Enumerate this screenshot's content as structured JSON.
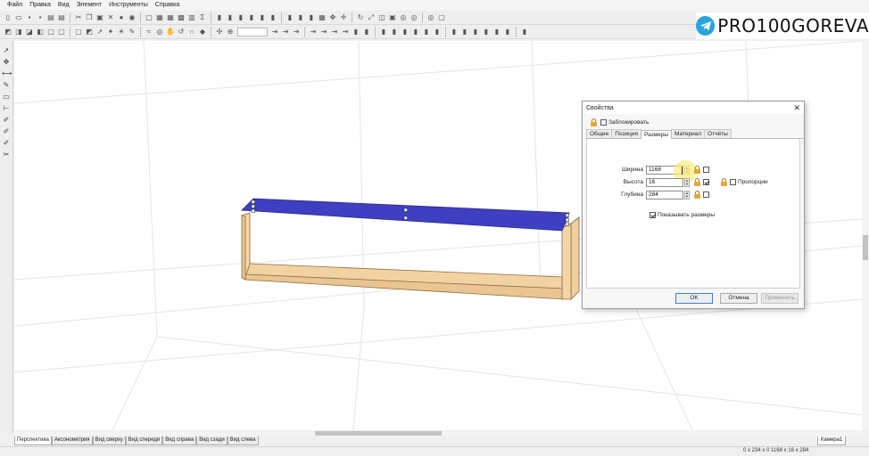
{
  "menu": [
    "Файл",
    "Правка",
    "Вид",
    "Элемент",
    "Инструменты",
    "Справка"
  ],
  "toolbar1_icons": [
    "new-icon",
    "open-icon",
    "save-icon",
    "save-as-icon",
    "print-icon",
    "print-preview-icon",
    "cut-icon",
    "copy-icon",
    "paste-icon",
    "delete-icon",
    "globe-icon",
    "sphere-icon",
    "window-icon",
    "layers-icon",
    "grid-icon",
    "image-icon",
    "library-icon",
    "sum-icon",
    "align-icon",
    "align-icon",
    "align-icon",
    "align-icon",
    "align-icon",
    "align-icon",
    "align-icon",
    "align-icon",
    "align-icon",
    "grid-snap-icon",
    "cursor-icon",
    "move-icon",
    "rotate-icon",
    "scale-icon",
    "mirror-icon",
    "group-icon",
    "eye-icon",
    "eye-icon",
    "eye-icon",
    "view-icon"
  ],
  "toolbar2_icons": [
    "cube-icon",
    "cube-front-icon",
    "cube-top-icon",
    "cube-side-icon",
    "box-icon",
    "box-icon",
    "box-icon",
    "cube-icon",
    "select-icon",
    "bulb-icon",
    "light-icon",
    "brush-icon",
    "wave-icon",
    "eye-icon",
    "hand-icon",
    "rotate-view-icon",
    "magnet-icon",
    "node-icon",
    "pan-icon",
    "zoom-icon",
    "zoom-combo",
    "arrow-icon",
    "arrow-icon",
    "arrow-icon",
    "arrow-icon",
    "arrow-icon",
    "arrow-icon",
    "arrow-icon",
    "align-icon",
    "align-icon",
    "align-icon",
    "align-icon",
    "align-icon",
    "align-icon",
    "align-icon",
    "align-icon",
    "align-icon",
    "align-icon",
    "align-icon",
    "align-icon",
    "align-icon",
    "align-icon",
    "align-icon"
  ],
  "left_tools": [
    "pointer-icon",
    "move-tool-icon",
    "measure-icon",
    "eyedropper-icon",
    "rectangle-tool-icon",
    "dimension-icon",
    "pen-icon",
    "pen-icon",
    "pen-icon",
    "scissors-icon"
  ],
  "logo": {
    "text": "PRO100GOREVA"
  },
  "view_tabs": [
    "Перспектива",
    "Аксонометрия",
    "Вид сверху",
    "Вид спереди",
    "Вид справа",
    "Вид сзади",
    "Вид слева"
  ],
  "camera_tab": "Камера1",
  "status": {
    "coords": "0 x 234 x 0   1168 x 16 x 284"
  },
  "dialog": {
    "title": "Свойства",
    "lock_label": "Заблокировать",
    "tabs": [
      "Общее",
      "Позиция",
      "Размеры",
      "Материал",
      "Отчёты"
    ],
    "active_tab": 2,
    "fields": [
      {
        "label": "Ширина",
        "value": "1168",
        "checked": false
      },
      {
        "label": "Высота",
        "value": "16",
        "checked": true
      },
      {
        "label": "Глубина",
        "value": "284",
        "checked": false
      }
    ],
    "proportions_label": "Пропорции",
    "show_dims_label": "Показывать размеры",
    "buttons": {
      "ok": "OK",
      "cancel": "Отмена",
      "apply": "Применить"
    }
  },
  "colors": {
    "selected_panel": "#3f3fc1",
    "wood_light": "#f3d6a8",
    "wood_dark": "#c8a06b",
    "telegram_blue": "#2aa3dd"
  }
}
